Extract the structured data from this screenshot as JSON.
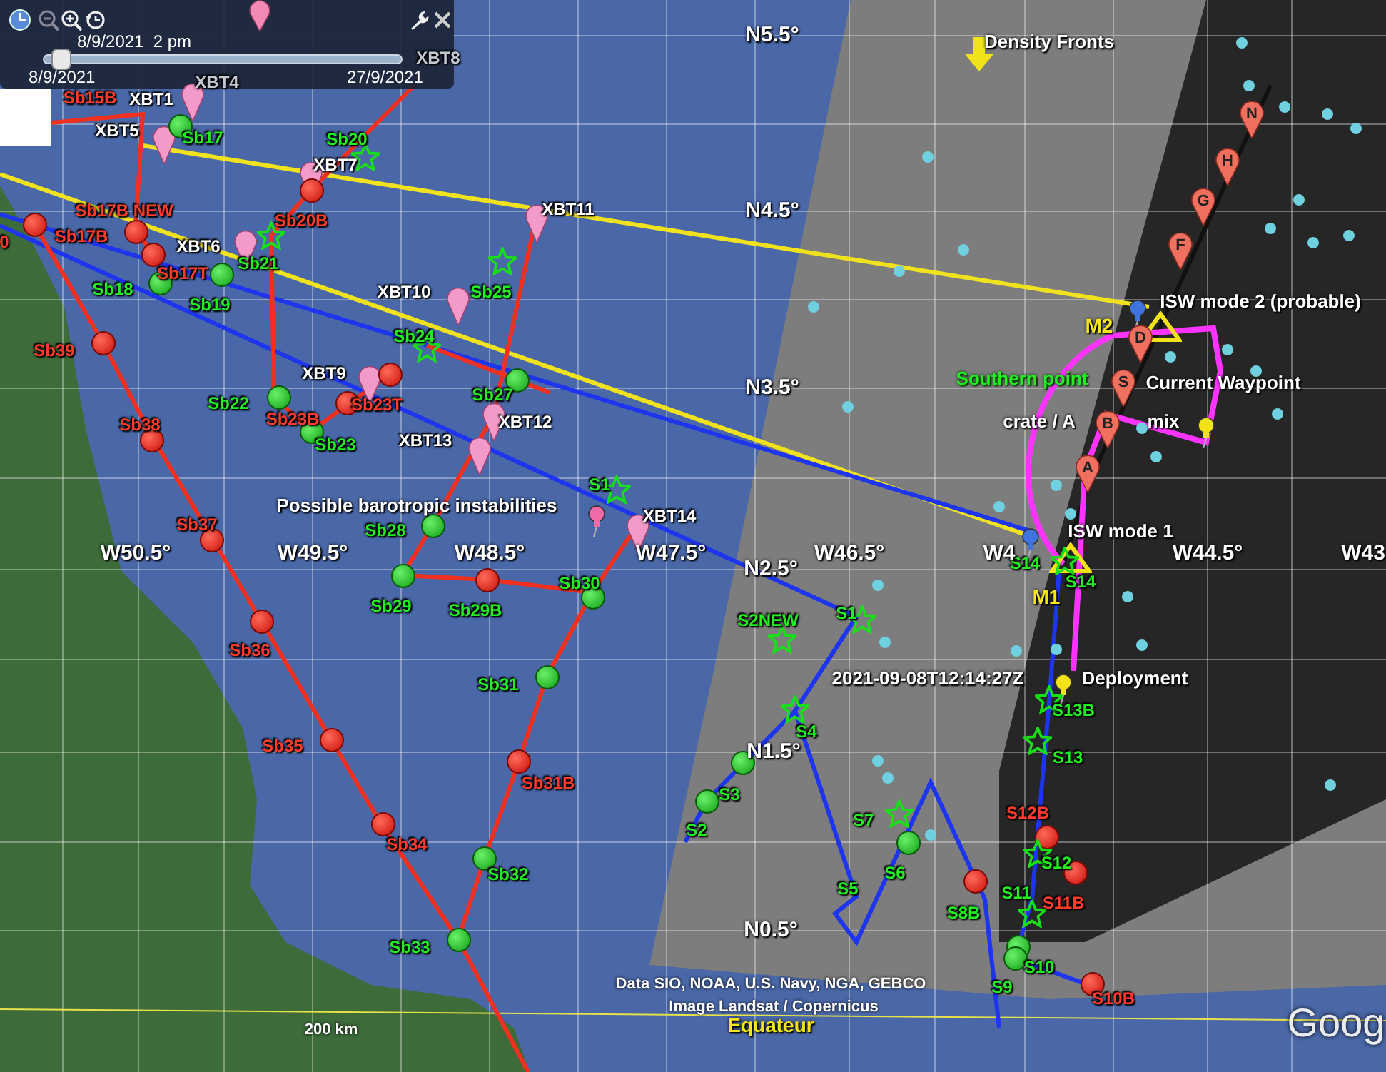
{
  "time_slider": {
    "current": "8/9/2021  2 pm",
    "start": "8/9/2021",
    "end": "27/9/2021",
    "level": 0.02
  },
  "grid_labels": [
    "N5.5°",
    "N4.5°",
    "N3.5°",
    "N2.5°",
    "N1.5°",
    "N0.5°",
    "W50.5°",
    "W49.5°",
    "W48.5°",
    "W47.5°",
    "W46.5°",
    "W4",
    "W44.5°",
    "W43"
  ],
  "markers": [
    {
      "label": "XBT8",
      "kind": "none",
      "color": "#c4c8d0"
    },
    {
      "label": "XBT4",
      "kind": "none",
      "color": "#c4c8d0"
    },
    {
      "label": "Sb15B",
      "kind": "none",
      "color": "#ff3b2b"
    },
    {
      "label": "XBT1",
      "kind": "pin",
      "color": "#ffffff"
    },
    {
      "label": "N",
      "kind": "letter_pin"
    },
    {
      "label": "XBT5",
      "kind": "pin",
      "color": "#ffffff"
    },
    {
      "label": "Sb17",
      "kind": "green_dot",
      "color": "#22ee22"
    },
    {
      "label": "Sb20",
      "kind": "star",
      "color": "#22ee22"
    },
    {
      "label": "XBT7",
      "kind": "pin",
      "color": "#ffffff"
    },
    {
      "label": "H",
      "kind": "letter_pin"
    },
    {
      "label": "XBT11",
      "kind": "pin",
      "color": "#ffffff"
    },
    {
      "label": "Sb17B NEW",
      "kind": "red_dot",
      "color": "#ff3b2b"
    },
    {
      "label": "G",
      "kind": "letter_pin"
    },
    {
      "label": "Sb20B",
      "kind": "red_dot",
      "color": "#ff3b2b"
    },
    {
      "label": "Sb17B",
      "kind": "red_dot",
      "color": "#ff3b2b"
    },
    {
      "label": "0",
      "kind": "none",
      "color": "#ff3b2b"
    },
    {
      "label": "XBT6",
      "kind": "pin",
      "color": "#ffffff"
    },
    {
      "label": "F",
      "kind": "letter_pin"
    },
    {
      "label": "Sb21",
      "kind": "star",
      "color": "#22ee22"
    },
    {
      "label": "Sb17T",
      "kind": "red_dot",
      "color": "#ff3b2b"
    },
    {
      "label": "Sb18",
      "kind": "green_dot",
      "color": "#22ee22"
    },
    {
      "label": "XBT10",
      "kind": "pin",
      "color": "#ffffff"
    },
    {
      "label": "Sb25",
      "kind": "star",
      "color": "#22ee22"
    },
    {
      "label": "Sb19",
      "kind": "green_dot",
      "color": "#22ee22"
    },
    {
      "label": "Sb24",
      "kind": "star",
      "color": "#22ee22"
    },
    {
      "label": "Sb39",
      "kind": "red_dot",
      "color": "#ff3b2b"
    },
    {
      "label": "D",
      "kind": "letter_pin"
    },
    {
      "label": "XBT9",
      "kind": "pin",
      "color": "#ffffff"
    },
    {
      "label": "Sb27",
      "kind": "green_dot",
      "color": "#22ee22"
    },
    {
      "label": "S",
      "kind": "letter_pin"
    },
    {
      "label": "Sb22",
      "kind": "green_dot",
      "color": "#22ee22"
    },
    {
      "label": "Sb23T",
      "kind": "red_dot",
      "color": "#ff3b2b"
    },
    {
      "label": "Sb38",
      "kind": "red_dot",
      "color": "#ff3b2b"
    },
    {
      "label": "Sb23B",
      "kind": "red_dot",
      "color": "#ff3b2b"
    },
    {
      "label": "XBT12",
      "kind": "pin",
      "color": "#ffffff"
    },
    {
      "label": "B",
      "kind": "letter_pin"
    },
    {
      "label": "XBT13",
      "kind": "pin",
      "color": "#ffffff"
    },
    {
      "label": "Sb23",
      "kind": "green_dot",
      "color": "#22ee22"
    },
    {
      "label": "A",
      "kind": "letter_pin"
    },
    {
      "label": "S1",
      "kind": "star",
      "color": "#22ee22"
    },
    {
      "label": "XBT14",
      "kind": "pin",
      "color": "#ffffff"
    },
    {
      "label": "Sb37",
      "kind": "red_dot",
      "color": "#ff3b2b"
    },
    {
      "label": "Sb28",
      "kind": "green_dot",
      "color": "#22ee22"
    },
    {
      "label": "S14",
      "kind": "none",
      "color": "#22ee22"
    },
    {
      "label": "S14",
      "kind": "star",
      "color": "#22ee22"
    },
    {
      "label": "Sb30",
      "kind": "green_dot",
      "color": "#22ee22"
    },
    {
      "label": "Sb29",
      "kind": "green_dot",
      "color": "#22ee22"
    },
    {
      "label": "Sb29B",
      "kind": "red_dot",
      "color": "#22ee22"
    },
    {
      "label": "S1",
      "kind": "star",
      "color": "#22ee22"
    },
    {
      "label": "S2NEW",
      "kind": "star",
      "color": "#22ee22"
    },
    {
      "label": "Sb36",
      "kind": "red_dot",
      "color": "#ff3b2b"
    },
    {
      "label": "Sb31",
      "kind": "green_dot",
      "color": "#22ee22"
    },
    {
      "label": "S13B",
      "kind": "star",
      "color": "#22ee22"
    },
    {
      "label": "S4",
      "kind": "star",
      "color": "#22ee22"
    },
    {
      "label": "Sb35",
      "kind": "red_dot",
      "color": "#ff3b2b"
    },
    {
      "label": "S13",
      "kind": "star",
      "color": "#22ee22"
    },
    {
      "label": "Sb31B",
      "kind": "red_dot",
      "color": "#ff3b2b"
    },
    {
      "label": "S3",
      "kind": "green_dot",
      "color": "#22ee22"
    },
    {
      "label": "S12B",
      "kind": "red_dot",
      "color": "#ff3b2b"
    },
    {
      "label": "S7",
      "kind": "star",
      "color": "#22ee22"
    },
    {
      "label": "S2",
      "kind": "green_dot",
      "color": "#22ee22"
    },
    {
      "label": "Sb34",
      "kind": "red_dot",
      "color": "#ff3b2b"
    },
    {
      "label": "S12",
      "kind": "star",
      "color": "#22ee22"
    },
    {
      "label": "S6",
      "kind": "green_dot",
      "color": "#22ee22"
    },
    {
      "label": "Sb32",
      "kind": "green_dot",
      "color": "#22ee22"
    },
    {
      "label": "S5",
      "kind": "none",
      "color": "#22ee22"
    },
    {
      "label": "S11",
      "kind": "star",
      "color": "#22ee22"
    },
    {
      "label": "S11B",
      "kind": "red_dot",
      "color": "#ff3b2b"
    },
    {
      "label": "S8B",
      "kind": "red_dot",
      "color": "#22ee22"
    },
    {
      "label": "Sb33",
      "kind": "green_dot",
      "color": "#22ee22"
    },
    {
      "label": "S10",
      "kind": "green_dot",
      "color": "#22ee22"
    },
    {
      "label": "S9",
      "kind": "green_dot",
      "color": "#22ee22"
    },
    {
      "label": "S10B",
      "kind": "red_dot",
      "color": "#ff3b2b"
    }
  ],
  "annotations": [
    {
      "text": "Density Fronts",
      "kind": "white"
    },
    {
      "text": "ISW mode 2 (probable)",
      "kind": "white"
    },
    {
      "text": "M2",
      "kind": "yellow"
    },
    {
      "text": "Southern point",
      "kind": "green"
    },
    {
      "text": "Current Waypoint",
      "kind": "white"
    },
    {
      "text": "crate / A",
      "kind": "white"
    },
    {
      "text": "mix",
      "kind": "white"
    },
    {
      "text": "Possible barotropic instabilities",
      "kind": "white"
    },
    {
      "text": "ISW mode 1",
      "kind": "white"
    },
    {
      "text": "M1",
      "kind": "yellow"
    },
    {
      "text": "2021-09-08T12:14:27Z",
      "kind": "white"
    },
    {
      "text": "Deployment",
      "kind": "white"
    },
    {
      "text": "Data SIO, NOAA, U.S. Navy, NGA, GEBCO",
      "kind": "credit"
    },
    {
      "text": "Image Landsat / Copernicus",
      "kind": "credit"
    },
    {
      "text": "200 km",
      "kind": "credit"
    },
    {
      "text": "Equateur",
      "kind": "yellow"
    },
    {
      "text": "Goog",
      "kind": "logo"
    }
  ]
}
